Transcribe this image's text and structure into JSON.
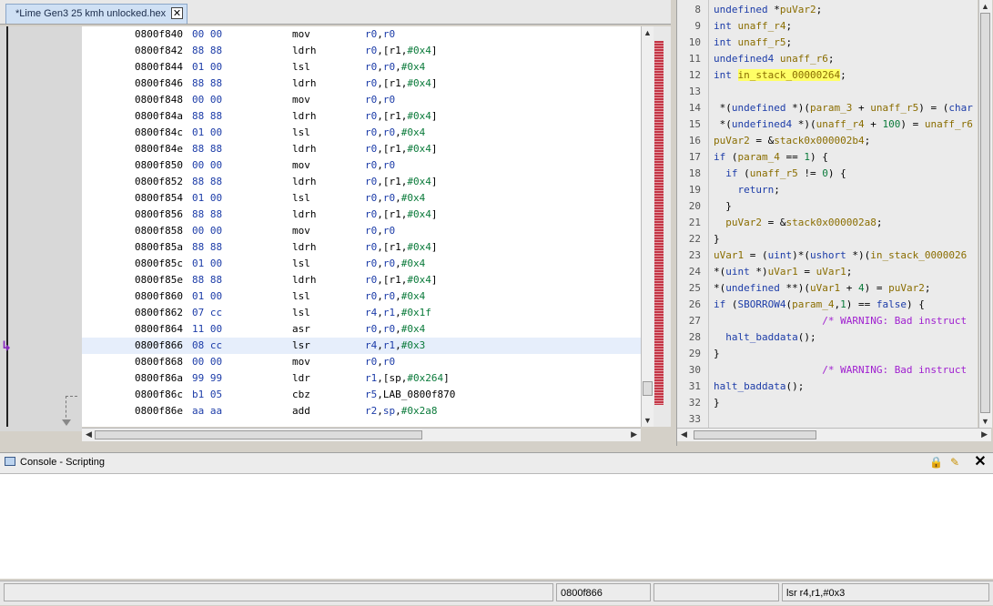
{
  "listing": {
    "tab_title": "*Lime Gen3 25 kmh unlocked.hex",
    "tab_close": "✕",
    "rows": [
      {
        "addr": "0800f840",
        "bytes": "00 00",
        "mnem": "mov",
        "ops": [
          [
            "reg",
            "r0"
          ],
          [
            "txt",
            ","
          ],
          [
            "reg",
            "r0"
          ]
        ]
      },
      {
        "addr": "0800f842",
        "bytes": "88 88",
        "mnem": "ldrh",
        "ops": [
          [
            "reg",
            "r0"
          ],
          [
            "txt",
            ",[r1,"
          ],
          [
            "num",
            "#0x4"
          ],
          [
            "txt",
            "]"
          ]
        ]
      },
      {
        "addr": "0800f844",
        "bytes": "01 00",
        "mnem": "lsl",
        "ops": [
          [
            "reg",
            "r0"
          ],
          [
            "txt",
            ","
          ],
          [
            "reg",
            "r0"
          ],
          [
            "txt",
            ","
          ],
          [
            "num",
            "#0x4"
          ]
        ]
      },
      {
        "addr": "0800f846",
        "bytes": "88 88",
        "mnem": "ldrh",
        "ops": [
          [
            "reg",
            "r0"
          ],
          [
            "txt",
            ",[r1,"
          ],
          [
            "num",
            "#0x4"
          ],
          [
            "txt",
            "]"
          ]
        ]
      },
      {
        "addr": "0800f848",
        "bytes": "00 00",
        "mnem": "mov",
        "ops": [
          [
            "reg",
            "r0"
          ],
          [
            "txt",
            ","
          ],
          [
            "reg",
            "r0"
          ]
        ]
      },
      {
        "addr": "0800f84a",
        "bytes": "88 88",
        "mnem": "ldrh",
        "ops": [
          [
            "reg",
            "r0"
          ],
          [
            "txt",
            ",[r1,"
          ],
          [
            "num",
            "#0x4"
          ],
          [
            "txt",
            "]"
          ]
        ]
      },
      {
        "addr": "0800f84c",
        "bytes": "01 00",
        "mnem": "lsl",
        "ops": [
          [
            "reg",
            "r0"
          ],
          [
            "txt",
            ","
          ],
          [
            "reg",
            "r0"
          ],
          [
            "txt",
            ","
          ],
          [
            "num",
            "#0x4"
          ]
        ]
      },
      {
        "addr": "0800f84e",
        "bytes": "88 88",
        "mnem": "ldrh",
        "ops": [
          [
            "reg",
            "r0"
          ],
          [
            "txt",
            ",[r1,"
          ],
          [
            "num",
            "#0x4"
          ],
          [
            "txt",
            "]"
          ]
        ]
      },
      {
        "addr": "0800f850",
        "bytes": "00 00",
        "mnem": "mov",
        "ops": [
          [
            "reg",
            "r0"
          ],
          [
            "txt",
            ","
          ],
          [
            "reg",
            "r0"
          ]
        ]
      },
      {
        "addr": "0800f852",
        "bytes": "88 88",
        "mnem": "ldrh",
        "ops": [
          [
            "reg",
            "r0"
          ],
          [
            "txt",
            ",[r1,"
          ],
          [
            "num",
            "#0x4"
          ],
          [
            "txt",
            "]"
          ]
        ]
      },
      {
        "addr": "0800f854",
        "bytes": "01 00",
        "mnem": "lsl",
        "ops": [
          [
            "reg",
            "r0"
          ],
          [
            "txt",
            ","
          ],
          [
            "reg",
            "r0"
          ],
          [
            "txt",
            ","
          ],
          [
            "num",
            "#0x4"
          ]
        ]
      },
      {
        "addr": "0800f856",
        "bytes": "88 88",
        "mnem": "ldrh",
        "ops": [
          [
            "reg",
            "r0"
          ],
          [
            "txt",
            ",[r1,"
          ],
          [
            "num",
            "#0x4"
          ],
          [
            "txt",
            "]"
          ]
        ]
      },
      {
        "addr": "0800f858",
        "bytes": "00 00",
        "mnem": "mov",
        "ops": [
          [
            "reg",
            "r0"
          ],
          [
            "txt",
            ","
          ],
          [
            "reg",
            "r0"
          ]
        ]
      },
      {
        "addr": "0800f85a",
        "bytes": "88 88",
        "mnem": "ldrh",
        "ops": [
          [
            "reg",
            "r0"
          ],
          [
            "txt",
            ",[r1,"
          ],
          [
            "num",
            "#0x4"
          ],
          [
            "txt",
            "]"
          ]
        ]
      },
      {
        "addr": "0800f85c",
        "bytes": "01 00",
        "mnem": "lsl",
        "ops": [
          [
            "reg",
            "r0"
          ],
          [
            "txt",
            ","
          ],
          [
            "reg",
            "r0"
          ],
          [
            "txt",
            ","
          ],
          [
            "num",
            "#0x4"
          ]
        ]
      },
      {
        "addr": "0800f85e",
        "bytes": "88 88",
        "mnem": "ldrh",
        "ops": [
          [
            "reg",
            "r0"
          ],
          [
            "txt",
            ",[r1,"
          ],
          [
            "num",
            "#0x4"
          ],
          [
            "txt",
            "]"
          ]
        ]
      },
      {
        "addr": "0800f860",
        "bytes": "01 00",
        "mnem": "lsl",
        "ops": [
          [
            "reg",
            "r0"
          ],
          [
            "txt",
            ","
          ],
          [
            "reg",
            "r0"
          ],
          [
            "txt",
            ","
          ],
          [
            "num",
            "#0x4"
          ]
        ]
      },
      {
        "addr": "0800f862",
        "bytes": "07 cc",
        "mnem": "lsl",
        "ops": [
          [
            "reg",
            "r4"
          ],
          [
            "txt",
            ","
          ],
          [
            "reg",
            "r1"
          ],
          [
            "txt",
            ","
          ],
          [
            "num",
            "#0x1f"
          ]
        ]
      },
      {
        "addr": "0800f864",
        "bytes": "11 00",
        "mnem": "asr",
        "ops": [
          [
            "reg",
            "r0"
          ],
          [
            "txt",
            ","
          ],
          [
            "reg",
            "r0"
          ],
          [
            "txt",
            ","
          ],
          [
            "num",
            "#0x4"
          ]
        ]
      },
      {
        "addr": "0800f866",
        "bytes": "08 cc",
        "mnem": "lsr",
        "ops": [
          [
            "reg",
            "r4"
          ],
          [
            "txt",
            ","
          ],
          [
            "reg",
            "r1"
          ],
          [
            "txt",
            ","
          ],
          [
            "num",
            "#0x3"
          ]
        ],
        "selected": true
      },
      {
        "addr": "0800f868",
        "bytes": "00 00",
        "mnem": "mov",
        "ops": [
          [
            "reg",
            "r0"
          ],
          [
            "txt",
            ","
          ],
          [
            "reg",
            "r0"
          ]
        ]
      },
      {
        "addr": "0800f86a",
        "bytes": "99 99",
        "mnem": "ldr",
        "ops": [
          [
            "reg",
            "r1"
          ],
          [
            "txt",
            ",[sp,"
          ],
          [
            "num",
            "#0x264"
          ],
          [
            "txt",
            "]"
          ]
        ]
      },
      {
        "addr": "0800f86c",
        "bytes": "b1 05",
        "mnem": "cbz",
        "ops": [
          [
            "reg",
            "r5"
          ],
          [
            "txt",
            ",LAB_0800f870"
          ]
        ]
      },
      {
        "addr": "0800f86e",
        "bytes": "aa aa",
        "mnem": "add",
        "ops": [
          [
            "reg",
            "r2"
          ],
          [
            "txt",
            ","
          ],
          [
            "reg",
            "sp"
          ],
          [
            "txt",
            ","
          ],
          [
            "num",
            "#0x2a8"
          ]
        ]
      }
    ]
  },
  "decompiler": {
    "lines": [
      {
        "n": "8",
        "parts": [
          [
            "kw",
            "undefined "
          ],
          [
            "txt",
            "*"
          ],
          [
            "var",
            "puVar2"
          ],
          [
            "txt",
            ";"
          ]
        ]
      },
      {
        "n": "9",
        "parts": [
          [
            "kw",
            "int "
          ],
          [
            "var",
            "unaff_r4"
          ],
          [
            "txt",
            ";"
          ]
        ]
      },
      {
        "n": "10",
        "parts": [
          [
            "kw",
            "int "
          ],
          [
            "var",
            "unaff_r5"
          ],
          [
            "txt",
            ";"
          ]
        ]
      },
      {
        "n": "11",
        "parts": [
          [
            "kw",
            "undefined4 "
          ],
          [
            "var",
            "unaff_r6"
          ],
          [
            "txt",
            ";"
          ]
        ]
      },
      {
        "n": "12",
        "parts": [
          [
            "kw",
            "int "
          ],
          [
            "hl",
            "in_stack_00000264"
          ],
          [
            "txt",
            ";"
          ]
        ]
      },
      {
        "n": "13",
        "parts": []
      },
      {
        "n": "14",
        "parts": [
          [
            "txt",
            " *("
          ],
          [
            "kw",
            "undefined "
          ],
          [
            "txt",
            "*)("
          ],
          [
            "var",
            "param_3"
          ],
          [
            "txt",
            " + "
          ],
          [
            "var",
            "unaff_r5"
          ],
          [
            "txt",
            ") = ("
          ],
          [
            "kw",
            "char"
          ]
        ]
      },
      {
        "n": "15",
        "parts": [
          [
            "txt",
            " *("
          ],
          [
            "kw",
            "undefined4 "
          ],
          [
            "txt",
            "*)("
          ],
          [
            "var",
            "unaff_r4"
          ],
          [
            "txt",
            " + "
          ],
          [
            "num",
            "100"
          ],
          [
            "txt",
            ") = "
          ],
          [
            "var",
            "unaff_r6"
          ]
        ]
      },
      {
        "n": "16",
        "parts": [
          [
            "var",
            "puVar2"
          ],
          [
            "txt",
            " = &"
          ],
          [
            "var",
            "stack0x000002b4"
          ],
          [
            "txt",
            ";"
          ]
        ]
      },
      {
        "n": "17",
        "parts": [
          [
            "kw",
            "if "
          ],
          [
            "txt",
            "("
          ],
          [
            "var",
            "param_4"
          ],
          [
            "txt",
            " == "
          ],
          [
            "num",
            "1"
          ],
          [
            "txt",
            ") {"
          ]
        ]
      },
      {
        "n": "18",
        "parts": [
          [
            "txt",
            "  "
          ],
          [
            "kw",
            "if "
          ],
          [
            "txt",
            "("
          ],
          [
            "var",
            "unaff_r5"
          ],
          [
            "txt",
            " != "
          ],
          [
            "num",
            "0"
          ],
          [
            "txt",
            ") {"
          ]
        ]
      },
      {
        "n": "19",
        "parts": [
          [
            "txt",
            "    "
          ],
          [
            "kw",
            "return"
          ],
          [
            "txt",
            ";"
          ]
        ]
      },
      {
        "n": "20",
        "parts": [
          [
            "txt",
            "  }"
          ]
        ]
      },
      {
        "n": "21",
        "parts": [
          [
            "txt",
            "  "
          ],
          [
            "var",
            "puVar2"
          ],
          [
            "txt",
            " = &"
          ],
          [
            "var",
            "stack0x000002a8"
          ],
          [
            "txt",
            ";"
          ]
        ]
      },
      {
        "n": "22",
        "parts": [
          [
            "txt",
            "}"
          ]
        ]
      },
      {
        "n": "23",
        "parts": [
          [
            "var",
            "uVar1"
          ],
          [
            "txt",
            " = ("
          ],
          [
            "kw",
            "uint"
          ],
          [
            "txt",
            ")*("
          ],
          [
            "kw",
            "ushort "
          ],
          [
            "txt",
            "*)("
          ],
          [
            "var",
            "in_stack_0000026"
          ]
        ]
      },
      {
        "n": "24",
        "parts": [
          [
            "txt",
            "*("
          ],
          [
            "kw",
            "uint "
          ],
          [
            "txt",
            "*)"
          ],
          [
            "var",
            "uVar1"
          ],
          [
            "txt",
            " = "
          ],
          [
            "var",
            "uVar1"
          ],
          [
            "txt",
            ";"
          ]
        ]
      },
      {
        "n": "25",
        "parts": [
          [
            "txt",
            "*("
          ],
          [
            "kw",
            "undefined "
          ],
          [
            "txt",
            "**)("
          ],
          [
            "var",
            "uVar1"
          ],
          [
            "txt",
            " + "
          ],
          [
            "num",
            "4"
          ],
          [
            "txt",
            ") = "
          ],
          [
            "var",
            "puVar2"
          ],
          [
            "txt",
            ";"
          ]
        ]
      },
      {
        "n": "26",
        "parts": [
          [
            "kw",
            "if "
          ],
          [
            "txt",
            "("
          ],
          [
            "fn",
            "SBORROW4"
          ],
          [
            "txt",
            "("
          ],
          [
            "var",
            "param_4"
          ],
          [
            "txt",
            ","
          ],
          [
            "num",
            "1"
          ],
          [
            "txt",
            ") == "
          ],
          [
            "kw",
            "false"
          ],
          [
            "txt",
            ") {"
          ]
        ]
      },
      {
        "n": "27",
        "parts": [
          [
            "txt",
            "                  "
          ],
          [
            "cmt",
            "/* WARNING: Bad instruct"
          ]
        ]
      },
      {
        "n": "28",
        "parts": [
          [
            "txt",
            "  "
          ],
          [
            "fn",
            "halt_baddata"
          ],
          [
            "txt",
            "();"
          ]
        ]
      },
      {
        "n": "29",
        "parts": [
          [
            "txt",
            "}"
          ]
        ]
      },
      {
        "n": "30",
        "parts": [
          [
            "txt",
            "                  "
          ],
          [
            "cmt",
            "/* WARNING: Bad instruct"
          ]
        ]
      },
      {
        "n": "31",
        "parts": [
          [
            "fn",
            "halt_baddata"
          ],
          [
            "txt",
            "();"
          ]
        ]
      },
      {
        "n": "32",
        "parts": [
          [
            "txt",
            "}"
          ]
        ]
      },
      {
        "n": "33",
        "parts": []
      }
    ]
  },
  "console": {
    "title": "Console - Scripting",
    "close_label": "✕",
    "lock_icon": "lock-icon",
    "clear_icon": "clear-icon"
  },
  "statusbar": {
    "address": "0800f866",
    "field2": "",
    "instruction": "lsr r4,r1,#0x3"
  },
  "colors": {
    "register": "#1c3ca8",
    "number": "#0a7a3a",
    "variable": "#8a6d00",
    "comment": "#a020d0",
    "highlight": "#ffff66",
    "overview_marker": "#c43646"
  }
}
